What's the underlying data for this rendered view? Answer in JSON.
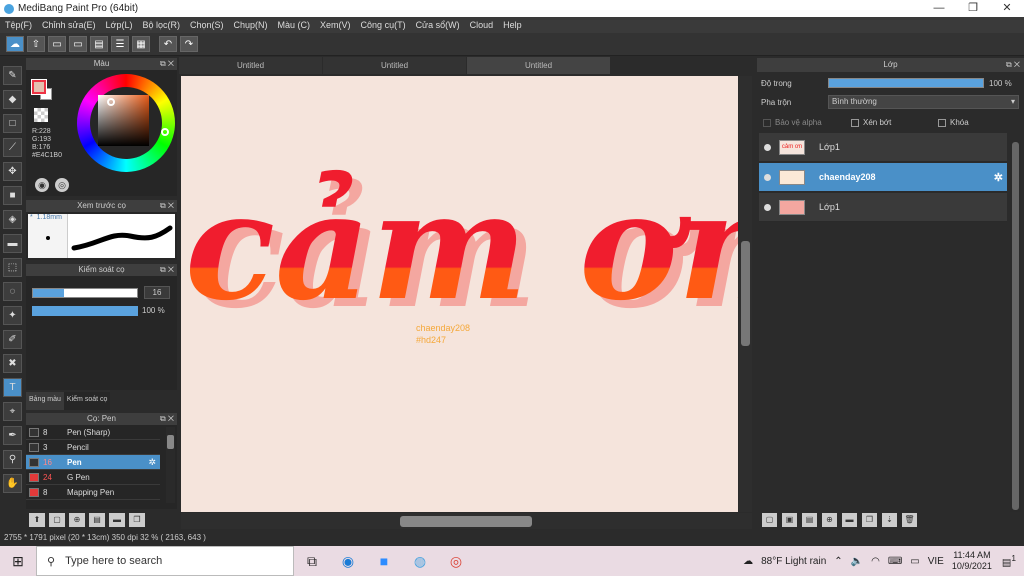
{
  "app": {
    "title": "MediBang Paint Pro (64bit)"
  },
  "window_buttons": [
    "—",
    "❐",
    "✕"
  ],
  "menu": [
    "Tệp(F)",
    "Chỉnh sửa(E)",
    "Lớp(L)",
    "Bộ lọc(R)",
    "Chọn(S)",
    "Chụp(N)",
    "Màu (C)",
    "Xem(V)",
    "Công cụ(T)",
    "Cửa sổ(W)",
    "Cloud",
    "Help"
  ],
  "color_panel": {
    "title": "Màu",
    "rgb": [
      "R:228",
      "G:193",
      "B:176",
      "#E4C1B0"
    ],
    "fg_color": "#E4C1B0"
  },
  "preview_panel": {
    "title": "Xem trước cọ",
    "size": "1.18mm"
  },
  "control_panel": {
    "title": "Kiểm soát cọ",
    "size_value": "16",
    "opacity_value": "100 %",
    "size_fraction": 0.3,
    "opacity_fraction": 1.0
  },
  "panel_tabs": [
    "Bảng màu",
    "Kiểm soát cọ"
  ],
  "brush_panel": {
    "title": "Cọ: Pen",
    "brushes": [
      {
        "size": "8",
        "name": "Pen (Sharp)",
        "color": "#333333"
      },
      {
        "size": "3",
        "name": "Pencil",
        "color": "#333333"
      },
      {
        "size": "16",
        "name": "Pen",
        "color": "#333333",
        "selected": true
      },
      {
        "size": "24",
        "name": "G Pen",
        "color": "#e23a3a"
      },
      {
        "size": "8",
        "name": "Mapping Pen",
        "color": "#e23a3a"
      }
    ]
  },
  "doc_tabs": [
    "Untitled",
    "Untitled",
    "Untitled"
  ],
  "canvas": {
    "lettering": "cảm ơn",
    "credit1": "chaenday208",
    "credit2": "#hd247",
    "bg": "#F5E4DC"
  },
  "status": "2755 * 1791 pixel  (20 * 13cm)  350 dpi  32 %  ( 2163, 643 )",
  "layer_panel": {
    "title": "Lớp",
    "opacity_label": "Độ trong",
    "opacity_value": "100 %",
    "blend_label": "Pha trộn",
    "blend_value": "Bình thường",
    "protect_alpha": "Bảo vệ alpha",
    "clip": "Xén bớt",
    "lock": "Khóa",
    "layers": [
      {
        "name": "Lớp1",
        "selected": false
      },
      {
        "name": "chaenday208",
        "selected": true
      },
      {
        "name": "Lớp1",
        "selected": false
      }
    ]
  },
  "taskbar": {
    "search_placeholder": "Type here to search",
    "weather": "88°F  Light rain",
    "lang": "VIE",
    "time": "11:44 AM",
    "date": "10/9/2021",
    "notif": "1"
  }
}
